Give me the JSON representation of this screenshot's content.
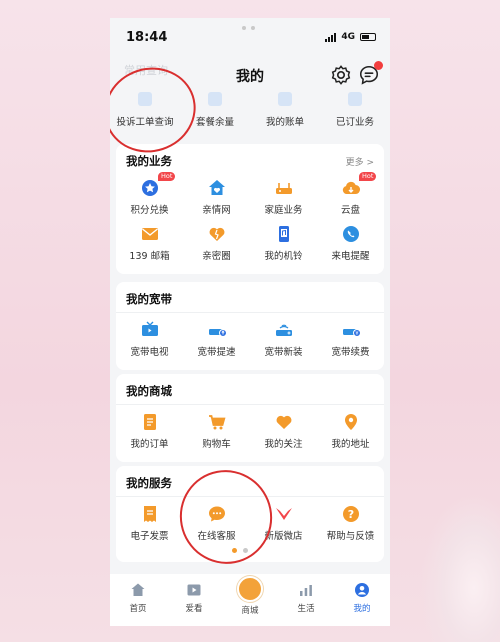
{
  "status": {
    "time": "18:44",
    "network": "4G"
  },
  "header": {
    "faded_label": "常用查询",
    "title": "我的"
  },
  "quick": [
    {
      "label": "投诉工单查询"
    },
    {
      "label": "套餐余量"
    },
    {
      "label": "我的账单"
    },
    {
      "label": "已订业务"
    }
  ],
  "business": {
    "title": "我的业务",
    "more": "更多 >",
    "hot": "Hot",
    "items": [
      {
        "label": "积分兑换",
        "icon": "points-icon"
      },
      {
        "label": "亲情网",
        "icon": "family-home-icon"
      },
      {
        "label": "家庭业务",
        "icon": "router-icon"
      },
      {
        "label": "云盘",
        "icon": "cloud-icon"
      },
      {
        "label": "139 邮箱",
        "icon": "mail-icon"
      },
      {
        "label": "亲密圈",
        "icon": "heart-icon"
      },
      {
        "label": "我的机铃",
        "icon": "ringtone-icon"
      },
      {
        "label": "来电提醒",
        "icon": "call-reminder-icon"
      }
    ]
  },
  "broadband": {
    "title": "我的宽带",
    "items": [
      {
        "label": "宽带电视",
        "icon": "tv-icon"
      },
      {
        "label": "宽带提速",
        "icon": "speedup-icon"
      },
      {
        "label": "宽带新装",
        "icon": "new-install-icon"
      },
      {
        "label": "宽带续费",
        "icon": "renew-icon"
      }
    ]
  },
  "mall": {
    "title": "我的商城",
    "items": [
      {
        "label": "我的订单",
        "icon": "orders-icon"
      },
      {
        "label": "购物车",
        "icon": "cart-icon"
      },
      {
        "label": "我的关注",
        "icon": "favorites-icon"
      },
      {
        "label": "我的地址",
        "icon": "location-icon"
      }
    ]
  },
  "service": {
    "title": "我的服务",
    "items": [
      {
        "label": "电子发票",
        "icon": "invoice-icon"
      },
      {
        "label": "在线客服",
        "icon": "chat-icon"
      },
      {
        "label": "新版微店",
        "icon": "shop-icon"
      },
      {
        "label": "帮助与反馈",
        "icon": "help-icon"
      }
    ]
  },
  "tabbar": [
    {
      "label": "首页"
    },
    {
      "label": "爱看"
    },
    {
      "label": "商城"
    },
    {
      "label": "生活"
    },
    {
      "label": "我的"
    }
  ],
  "colors": {
    "accent_blue": "#2d6fe0",
    "accent_orange": "#f39a2b",
    "annotation_red": "#d92f2f"
  }
}
